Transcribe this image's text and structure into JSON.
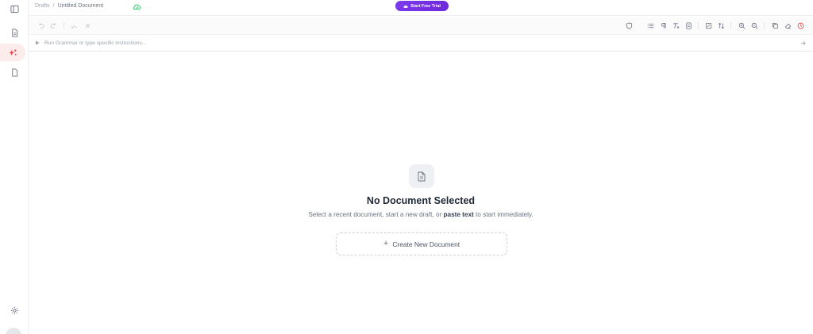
{
  "breadcrumb": {
    "root": "Drafts",
    "separator": "/",
    "current": "Untitled Document"
  },
  "header": {
    "trial_button": "Start Free Trial",
    "trial_icon": "crown-icon"
  },
  "sidebar": {
    "items": [
      {
        "icon": "sidebar-toggle-icon"
      },
      {
        "icon": "document-icon"
      },
      {
        "icon": "sparkle-icon",
        "active": true
      },
      {
        "icon": "page-icon"
      },
      {
        "icon": "settings-icon"
      }
    ]
  },
  "toolbar": {
    "icons": [
      "undo-icon",
      "redo-icon",
      "spellcheck-icon",
      "clear-icon",
      "shield-icon",
      "list-icon",
      "paragraph-icon",
      "clear-format-icon",
      "document-info-icon",
      "edit-icon",
      "sort-icon",
      "zoom-in-icon",
      "zoom-out-icon",
      "copy-icon",
      "eraser-icon",
      "history-icon"
    ]
  },
  "instruction": {
    "placeholder": "Run Grammar or type specific instructions..."
  },
  "empty_state": {
    "title": "No Document Selected",
    "subtitle_pre": "Select a recent document, start a new draft, or ",
    "subtitle_bold": "paste text",
    "subtitle_post": " to start immediately.",
    "create_label": "Create New Document"
  },
  "colors": {
    "accent": "#7c3aed",
    "active_rail": "#fdecec",
    "alert": "#ef4444",
    "sync": "#22c55e"
  }
}
